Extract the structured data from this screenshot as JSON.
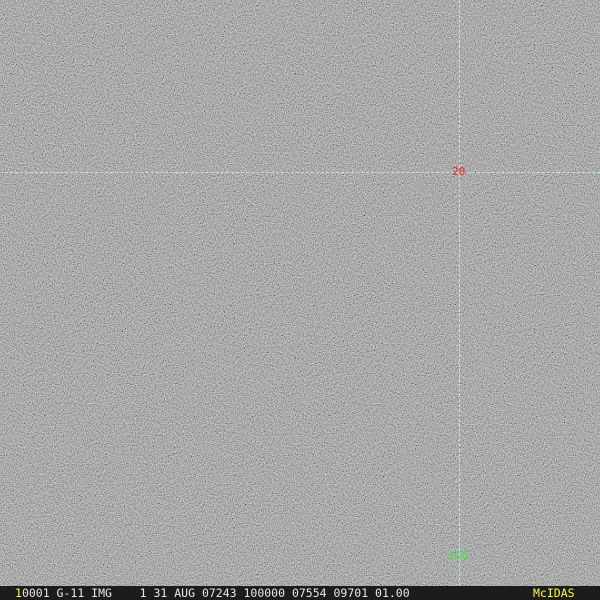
{
  "image": {
    "lat_label": "20",
    "lon_label": "115",
    "colors": {
      "lat_label": "#ff2020",
      "lon_label": "#20ff20",
      "grid": "#b8e8ee",
      "status_bar": "#1c1c1c",
      "status_highlight": "#ffff33"
    }
  },
  "status_bar": {
    "frame_number": "1",
    "info": "0001 G-11 IMG    1 31 AUG 07243 100000 07554 09701 01.00",
    "brand": "McIDAS"
  }
}
